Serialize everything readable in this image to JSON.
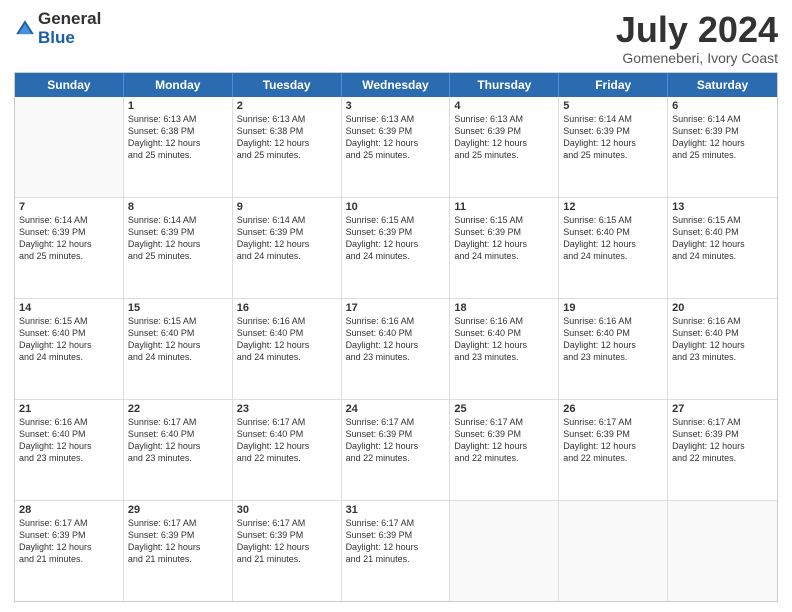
{
  "logo": {
    "general": "General",
    "blue": "Blue"
  },
  "title": {
    "month_year": "July 2024",
    "location": "Gomeneberi, Ivory Coast"
  },
  "header_days": [
    "Sunday",
    "Monday",
    "Tuesday",
    "Wednesday",
    "Thursday",
    "Friday",
    "Saturday"
  ],
  "weeks": [
    [
      {
        "day": "",
        "lines": []
      },
      {
        "day": "1",
        "lines": [
          "Sunrise: 6:13 AM",
          "Sunset: 6:38 PM",
          "Daylight: 12 hours",
          "and 25 minutes."
        ]
      },
      {
        "day": "2",
        "lines": [
          "Sunrise: 6:13 AM",
          "Sunset: 6:38 PM",
          "Daylight: 12 hours",
          "and 25 minutes."
        ]
      },
      {
        "day": "3",
        "lines": [
          "Sunrise: 6:13 AM",
          "Sunset: 6:39 PM",
          "Daylight: 12 hours",
          "and 25 minutes."
        ]
      },
      {
        "day": "4",
        "lines": [
          "Sunrise: 6:13 AM",
          "Sunset: 6:39 PM",
          "Daylight: 12 hours",
          "and 25 minutes."
        ]
      },
      {
        "day": "5",
        "lines": [
          "Sunrise: 6:14 AM",
          "Sunset: 6:39 PM",
          "Daylight: 12 hours",
          "and 25 minutes."
        ]
      },
      {
        "day": "6",
        "lines": [
          "Sunrise: 6:14 AM",
          "Sunset: 6:39 PM",
          "Daylight: 12 hours",
          "and 25 minutes."
        ]
      }
    ],
    [
      {
        "day": "7",
        "lines": [
          "Sunrise: 6:14 AM",
          "Sunset: 6:39 PM",
          "Daylight: 12 hours",
          "and 25 minutes."
        ]
      },
      {
        "day": "8",
        "lines": [
          "Sunrise: 6:14 AM",
          "Sunset: 6:39 PM",
          "Daylight: 12 hours",
          "and 25 minutes."
        ]
      },
      {
        "day": "9",
        "lines": [
          "Sunrise: 6:14 AM",
          "Sunset: 6:39 PM",
          "Daylight: 12 hours",
          "and 24 minutes."
        ]
      },
      {
        "day": "10",
        "lines": [
          "Sunrise: 6:15 AM",
          "Sunset: 6:39 PM",
          "Daylight: 12 hours",
          "and 24 minutes."
        ]
      },
      {
        "day": "11",
        "lines": [
          "Sunrise: 6:15 AM",
          "Sunset: 6:39 PM",
          "Daylight: 12 hours",
          "and 24 minutes."
        ]
      },
      {
        "day": "12",
        "lines": [
          "Sunrise: 6:15 AM",
          "Sunset: 6:40 PM",
          "Daylight: 12 hours",
          "and 24 minutes."
        ]
      },
      {
        "day": "13",
        "lines": [
          "Sunrise: 6:15 AM",
          "Sunset: 6:40 PM",
          "Daylight: 12 hours",
          "and 24 minutes."
        ]
      }
    ],
    [
      {
        "day": "14",
        "lines": [
          "Sunrise: 6:15 AM",
          "Sunset: 6:40 PM",
          "Daylight: 12 hours",
          "and 24 minutes."
        ]
      },
      {
        "day": "15",
        "lines": [
          "Sunrise: 6:15 AM",
          "Sunset: 6:40 PM",
          "Daylight: 12 hours",
          "and 24 minutes."
        ]
      },
      {
        "day": "16",
        "lines": [
          "Sunrise: 6:16 AM",
          "Sunset: 6:40 PM",
          "Daylight: 12 hours",
          "and 24 minutes."
        ]
      },
      {
        "day": "17",
        "lines": [
          "Sunrise: 6:16 AM",
          "Sunset: 6:40 PM",
          "Daylight: 12 hours",
          "and 23 minutes."
        ]
      },
      {
        "day": "18",
        "lines": [
          "Sunrise: 6:16 AM",
          "Sunset: 6:40 PM",
          "Daylight: 12 hours",
          "and 23 minutes."
        ]
      },
      {
        "day": "19",
        "lines": [
          "Sunrise: 6:16 AM",
          "Sunset: 6:40 PM",
          "Daylight: 12 hours",
          "and 23 minutes."
        ]
      },
      {
        "day": "20",
        "lines": [
          "Sunrise: 6:16 AM",
          "Sunset: 6:40 PM",
          "Daylight: 12 hours",
          "and 23 minutes."
        ]
      }
    ],
    [
      {
        "day": "21",
        "lines": [
          "Sunrise: 6:16 AM",
          "Sunset: 6:40 PM",
          "Daylight: 12 hours",
          "and 23 minutes."
        ]
      },
      {
        "day": "22",
        "lines": [
          "Sunrise: 6:17 AM",
          "Sunset: 6:40 PM",
          "Daylight: 12 hours",
          "and 23 minutes."
        ]
      },
      {
        "day": "23",
        "lines": [
          "Sunrise: 6:17 AM",
          "Sunset: 6:40 PM",
          "Daylight: 12 hours",
          "and 22 minutes."
        ]
      },
      {
        "day": "24",
        "lines": [
          "Sunrise: 6:17 AM",
          "Sunset: 6:39 PM",
          "Daylight: 12 hours",
          "and 22 minutes."
        ]
      },
      {
        "day": "25",
        "lines": [
          "Sunrise: 6:17 AM",
          "Sunset: 6:39 PM",
          "Daylight: 12 hours",
          "and 22 minutes."
        ]
      },
      {
        "day": "26",
        "lines": [
          "Sunrise: 6:17 AM",
          "Sunset: 6:39 PM",
          "Daylight: 12 hours",
          "and 22 minutes."
        ]
      },
      {
        "day": "27",
        "lines": [
          "Sunrise: 6:17 AM",
          "Sunset: 6:39 PM",
          "Daylight: 12 hours",
          "and 22 minutes."
        ]
      }
    ],
    [
      {
        "day": "28",
        "lines": [
          "Sunrise: 6:17 AM",
          "Sunset: 6:39 PM",
          "Daylight: 12 hours",
          "and 21 minutes."
        ]
      },
      {
        "day": "29",
        "lines": [
          "Sunrise: 6:17 AM",
          "Sunset: 6:39 PM",
          "Daylight: 12 hours",
          "and 21 minutes."
        ]
      },
      {
        "day": "30",
        "lines": [
          "Sunrise: 6:17 AM",
          "Sunset: 6:39 PM",
          "Daylight: 12 hours",
          "and 21 minutes."
        ]
      },
      {
        "day": "31",
        "lines": [
          "Sunrise: 6:17 AM",
          "Sunset: 6:39 PM",
          "Daylight: 12 hours",
          "and 21 minutes."
        ]
      },
      {
        "day": "",
        "lines": []
      },
      {
        "day": "",
        "lines": []
      },
      {
        "day": "",
        "lines": []
      }
    ]
  ]
}
